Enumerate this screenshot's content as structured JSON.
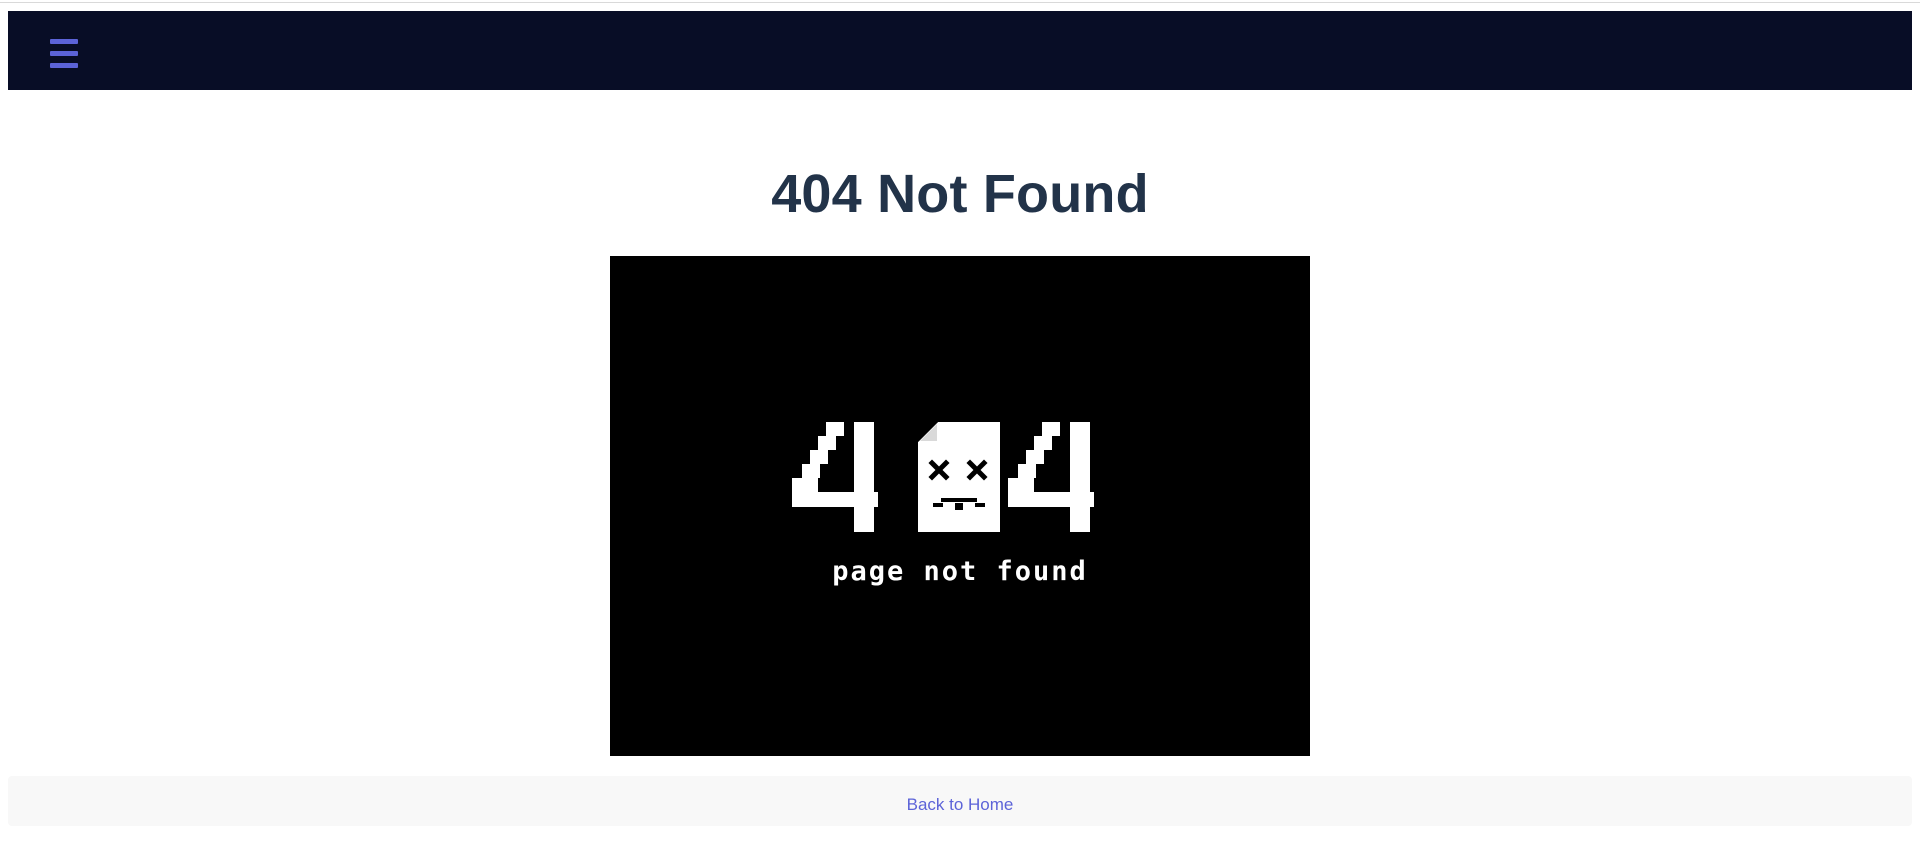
{
  "page": {
    "background": "#ffffff",
    "title": "404 Not Found",
    "title_color": "#223349"
  },
  "navbar": {
    "background": "#080d26",
    "menu_icon": "hamburger-menu-icon",
    "menu_icon_color": "#5c63d8"
  },
  "error_image": {
    "background": "#000000",
    "glyph_text": "404",
    "caption": "page not found",
    "document_icon": "sad-document-icon",
    "foreground": "#ffffff"
  },
  "footer": {
    "background": "#f8f8f8",
    "link_label": "Back to Home",
    "link_color": "#5c63d8"
  }
}
